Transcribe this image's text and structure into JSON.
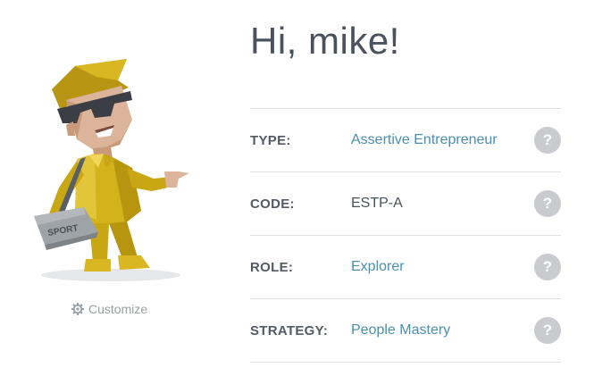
{
  "greeting": "Hi, mike!",
  "avatar": {
    "bag_label": "SPORT"
  },
  "customize": {
    "label": "Customize",
    "icon": "gear-icon"
  },
  "traits": [
    {
      "label": "TYPE:",
      "value": "Assertive Entrepreneur",
      "linked": true,
      "help": "?"
    },
    {
      "label": "CODE:",
      "value": "ESTP-A",
      "linked": false,
      "help": "?"
    },
    {
      "label": "ROLE:",
      "value": "Explorer",
      "linked": true,
      "help": "?"
    },
    {
      "label": "STRATEGY:",
      "value": "People Mastery",
      "linked": true,
      "help": "?"
    }
  ],
  "colors": {
    "heading": "#4b525c",
    "link": "#4a8fb0",
    "divider": "#dfe1e4",
    "help_button": "#c9cbce",
    "avatar_yellow": "#d4b21c"
  }
}
